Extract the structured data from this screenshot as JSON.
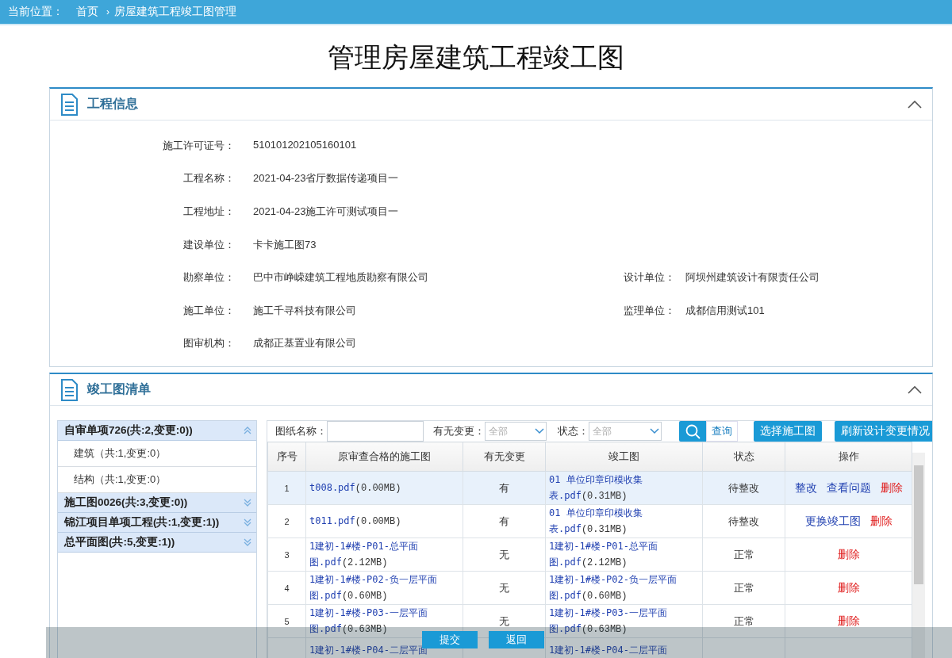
{
  "breadcrumb": {
    "label": "当前位置：",
    "separator": "›",
    "items": [
      "首页",
      "房屋建筑工程竣工图管理"
    ]
  },
  "page_title": "管理房屋建筑工程竣工图",
  "project_info": {
    "title": "工程信息",
    "expanded": true,
    "rows": [
      [
        {
          "label": "施工许可证号：",
          "value": "510101202105160101"
        }
      ],
      [
        {
          "label": "工程名称：",
          "value": "2021-04-23省厅数据传递项目一"
        }
      ],
      [
        {
          "label": "工程地址：",
          "value": "2021-04-23施工许可测试项目一"
        }
      ],
      [
        {
          "label": "建设单位：",
          "value": "卡卡施工图73"
        }
      ],
      [
        {
          "label": "勘察单位：",
          "value": "巴中市峥嵘建筑工程地质勘察有限公司"
        },
        {
          "label": "设计单位：",
          "value": "阿坝州建筑设计有限责任公司"
        }
      ],
      [
        {
          "label": "施工单位：",
          "value": "施工千寻科技有限公司"
        },
        {
          "label": "监理单位：",
          "value": "成都信用测试101"
        }
      ],
      [
        {
          "label": "图审机构：",
          "value": "成都正基置业有限公司"
        }
      ]
    ]
  },
  "drawing_list": {
    "title": "竣工图清单",
    "expanded": true,
    "groups": [
      {
        "label": "自审单项726(共:2,变更:0))",
        "expanded": true,
        "children": [
          {
            "label": "建筑（共:1,变更:0）"
          },
          {
            "label": "结构（共:1,变更:0）"
          }
        ]
      },
      {
        "label": "施工图0026(共:3,变更:0))",
        "expanded": false
      },
      {
        "label": "锦江项目单项工程(共:1,变更:1))",
        "expanded": false
      },
      {
        "label": "总平面图(共:5,变更:1))",
        "expanded": false
      }
    ],
    "filters": {
      "name_label": "图纸名称：",
      "change_label": "有无变更：",
      "change_value": "全部",
      "status_label": "状态：",
      "status_value": "全部",
      "search_button": "查询",
      "buttons": [
        "选择施工图",
        "刷新设计变更情况"
      ]
    },
    "columns": [
      "序号",
      "原审查合格的施工图",
      "有无变更",
      "竣工图",
      "状态",
      "操作"
    ],
    "rows": [
      {
        "no": "1",
        "selected": true,
        "original": {
          "file": "t008.pdf",
          "size": "(0.00MB)"
        },
        "changed": "有",
        "completed": {
          "file": "01 单位印章印模收集表.pdf",
          "size": "(0.31MB)"
        },
        "status": "待整改",
        "actions": [
          {
            "label": "整改",
            "kind": "link"
          },
          {
            "label": "查看问题",
            "kind": "link"
          },
          {
            "label": "删除",
            "kind": "delete"
          }
        ]
      },
      {
        "no": "2",
        "selected": false,
        "original": {
          "file": "t011.pdf",
          "size": "(0.00MB)"
        },
        "changed": "有",
        "completed": {
          "file": "01 单位印章印模收集表.pdf",
          "size": "(0.31MB)"
        },
        "status": "待整改",
        "actions": [
          {
            "label": "更换竣工图",
            "kind": "link"
          },
          {
            "label": "删除",
            "kind": "delete"
          }
        ]
      },
      {
        "no": "3",
        "selected": false,
        "original": {
          "file": "1建初-1#楼-P01-总平面图.pdf",
          "size": "(2.12MB)"
        },
        "changed": "无",
        "completed": {
          "file": "1建初-1#楼-P01-总平面图.pdf",
          "size": "(2.12MB)"
        },
        "status": "正常",
        "actions": [
          {
            "label": "删除",
            "kind": "delete"
          }
        ]
      },
      {
        "no": "4",
        "selected": false,
        "original": {
          "file": "1建初-1#楼-P02-负一层平面图.pdf",
          "size": "(0.60MB)"
        },
        "changed": "无",
        "completed": {
          "file": "1建初-1#楼-P02-负一层平面图.pdf",
          "size": "(0.60MB)"
        },
        "status": "正常",
        "actions": [
          {
            "label": "删除",
            "kind": "delete"
          }
        ]
      },
      {
        "no": "5",
        "selected": false,
        "original": {
          "file": "1建初-1#楼-P03-一层平面图.pdf",
          "size": "(0.63MB)"
        },
        "changed": "无",
        "completed": {
          "file": "1建初-1#楼-P03-一层平面图.pdf",
          "size": "(0.63MB)"
        },
        "status": "正常",
        "actions": [
          {
            "label": "删除",
            "kind": "delete"
          }
        ]
      },
      {
        "no": "",
        "selected": false,
        "original": {
          "file": "1建初-1#楼-P04-二层平面"
        },
        "changed": "",
        "completed": {
          "file": "1建初-1#楼-P04-二层平面"
        },
        "status": "",
        "actions": []
      }
    ]
  },
  "footer": {
    "buttons": [
      "提交",
      "返回"
    ]
  }
}
